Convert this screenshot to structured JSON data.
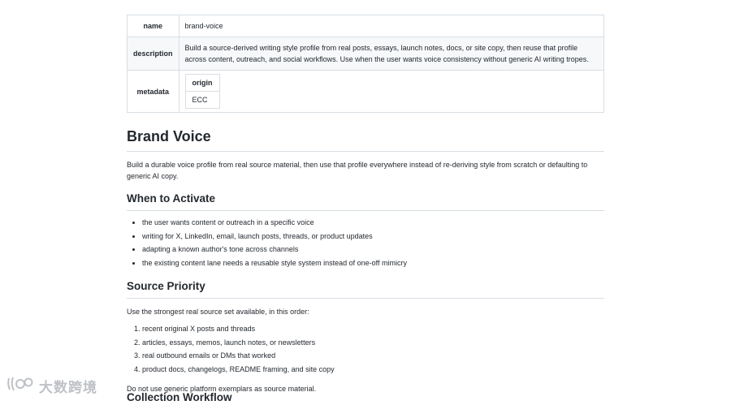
{
  "frontmatter": {
    "name_key": "name",
    "name_value": "brand-voice",
    "description_key": "description",
    "description_value": "Build a source-derived writing style profile from real posts, essays, launch notes, docs, or site copy, then reuse that profile across content, outreach, and social workflows. Use when the user wants voice consistency without generic AI writing tropes.",
    "metadata_key": "metadata",
    "metadata_header": "origin",
    "metadata_value": "ECC"
  },
  "title": "Brand Voice",
  "intro": "Build a durable voice profile from real source material, then use that profile everywhere instead of re-deriving style from scratch or defaulting to generic AI copy.",
  "activate": {
    "heading": "When to Activate",
    "items": [
      "the user wants content or outreach in a specific voice",
      "writing for X, LinkedIn, email, launch posts, threads, or product updates",
      "adapting a known author's tone across channels",
      "the existing content lane needs a reusable style system instead of one-off mimicry"
    ]
  },
  "priority": {
    "heading": "Source Priority",
    "lead": "Use the strongest real source set available, in this order:",
    "items": [
      "recent original X posts and threads",
      "articles, essays, memos, launch notes, or newsletters",
      "real outbound emails or DMs that worked",
      "product docs, changelogs, README framing, and site copy"
    ],
    "note": "Do not use generic platform exemplars as source material."
  },
  "next_heading": "Collection Workflow",
  "watermark": {
    "text": "大数跨境",
    "icon": "logo-icon"
  }
}
